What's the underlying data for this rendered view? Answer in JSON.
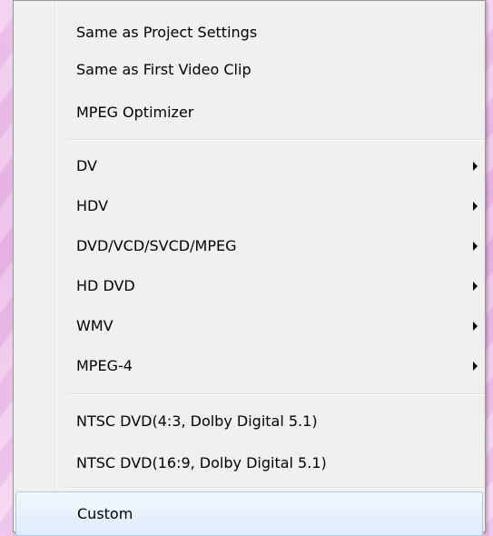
{
  "menu": {
    "groups": [
      {
        "items": [
          {
            "label": "Same as Project Settings"
          },
          {
            "label": "Same as First Video Clip"
          },
          {
            "label": "MPEG Optimizer"
          }
        ]
      },
      {
        "items": [
          {
            "label": "DV",
            "submenu": true
          },
          {
            "label": "HDV",
            "submenu": true
          },
          {
            "label": "DVD/VCD/SVCD/MPEG",
            "submenu": true
          },
          {
            "label": "HD DVD",
            "submenu": true
          },
          {
            "label": "WMV",
            "submenu": true
          },
          {
            "label": "MPEG-4",
            "submenu": true
          }
        ]
      },
      {
        "items": [
          {
            "label": "NTSC  DVD(4:3, Dolby Digital 5.1)"
          },
          {
            "label": "NTSC  DVD(16:9, Dolby Digital 5.1)"
          }
        ]
      },
      {
        "items": [
          {
            "label": "Custom",
            "highlighted": true
          }
        ]
      }
    ],
    "colors": {
      "menu_background": "#f0f0f0",
      "highlight": "#dfecfb",
      "highlight_border": "#aacbe8",
      "desktop_background": "#f0c6ec"
    }
  }
}
